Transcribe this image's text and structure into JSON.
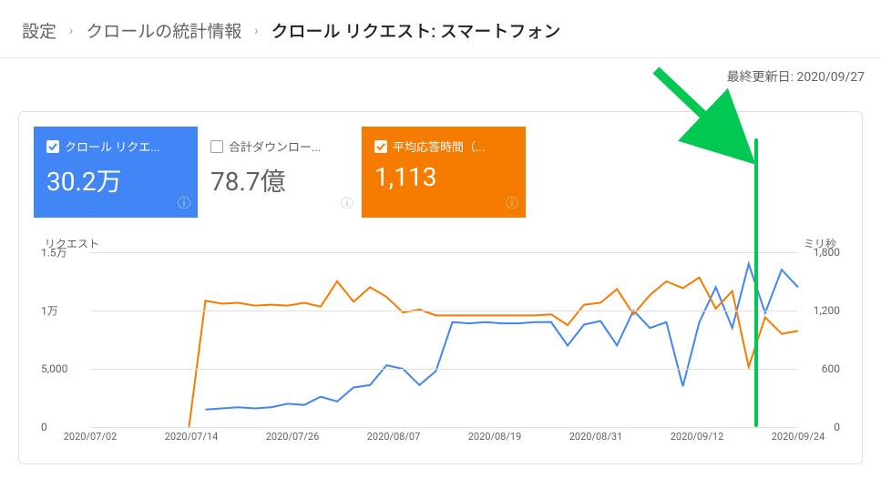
{
  "breadcrumb": {
    "items": [
      "設定",
      "クロールの統計情報",
      "クロール リクエスト: スマートフォン"
    ]
  },
  "last_updated_label": "最終更新日:",
  "last_updated_value": "2020/09/27",
  "metrics": {
    "requests": {
      "label": "クロール リクエ...",
      "value": "30.2万"
    },
    "download": {
      "label": "合計ダウンロー...",
      "value": "78.7億"
    },
    "latency": {
      "label": "平均応答時間（...",
      "value": "1,113"
    }
  },
  "chart_data": {
    "type": "line",
    "left_axis_title": "リクエスト",
    "right_axis_title": "ミリ秒",
    "left_ticks": [
      "1.5万",
      "1万",
      "5,000",
      "0"
    ],
    "right_ticks": [
      "1,800",
      "1,200",
      "600",
      "0"
    ],
    "left_ylim": [
      0,
      15000
    ],
    "right_ylim": [
      0,
      1800
    ],
    "x_ticks": [
      "2020/07/02",
      "2020/07/14",
      "2020/07/26",
      "2020/08/07",
      "2020/08/19",
      "2020/08/31",
      "2020/09/12",
      "2020/09/24"
    ],
    "categories": [
      "2020/07/02",
      "2020/07/04",
      "2020/07/06",
      "2020/07/08",
      "2020/07/10",
      "2020/07/12",
      "2020/07/14",
      "2020/07/16",
      "2020/07/18",
      "2020/07/20",
      "2020/07/22",
      "2020/07/24",
      "2020/07/26",
      "2020/07/28",
      "2020/07/30",
      "2020/08/01",
      "2020/08/03",
      "2020/08/05",
      "2020/08/07",
      "2020/08/09",
      "2020/08/11",
      "2020/08/13",
      "2020/08/15",
      "2020/08/17",
      "2020/08/19",
      "2020/08/21",
      "2020/08/23",
      "2020/08/25",
      "2020/08/27",
      "2020/08/29",
      "2020/08/31",
      "2020/09/02",
      "2020/09/04",
      "2020/09/06",
      "2020/09/08",
      "2020/09/10",
      "2020/09/12",
      "2020/09/14",
      "2020/09/16",
      "2020/09/18",
      "2020/09/20",
      "2020/09/22",
      "2020/09/24",
      "2020/09/26"
    ],
    "series": [
      {
        "name": "クロール リクエスト",
        "axis": "left",
        "color": "#4285f4",
        "values": [
          null,
          null,
          null,
          null,
          null,
          null,
          null,
          1500,
          1600,
          1700,
          1600,
          1700,
          2000,
          1900,
          2600,
          2200,
          3400,
          3600,
          5300,
          5000,
          3600,
          4800,
          9000,
          8900,
          9000,
          8900,
          8900,
          9000,
          9000,
          7000,
          8800,
          9100,
          7000,
          10000,
          8500,
          9000,
          3500,
          9000,
          12000,
          8500,
          14000,
          9800,
          13500,
          12000
        ]
      },
      {
        "name": "平均応答時間",
        "axis": "right",
        "color": "#f57c00",
        "values": [
          null,
          null,
          null,
          null,
          null,
          null,
          0,
          1300,
          1270,
          1280,
          1250,
          1260,
          1250,
          1280,
          1240,
          1500,
          1290,
          1440,
          1340,
          1180,
          1210,
          1150,
          1150,
          1150,
          1150,
          1150,
          1150,
          1150,
          1160,
          1050,
          1260,
          1280,
          1420,
          1160,
          1360,
          1500,
          1430,
          1540,
          1220,
          1400,
          620,
          1130,
          960,
          990
        ]
      }
    ],
    "annotation_x": "2020/09/19"
  }
}
